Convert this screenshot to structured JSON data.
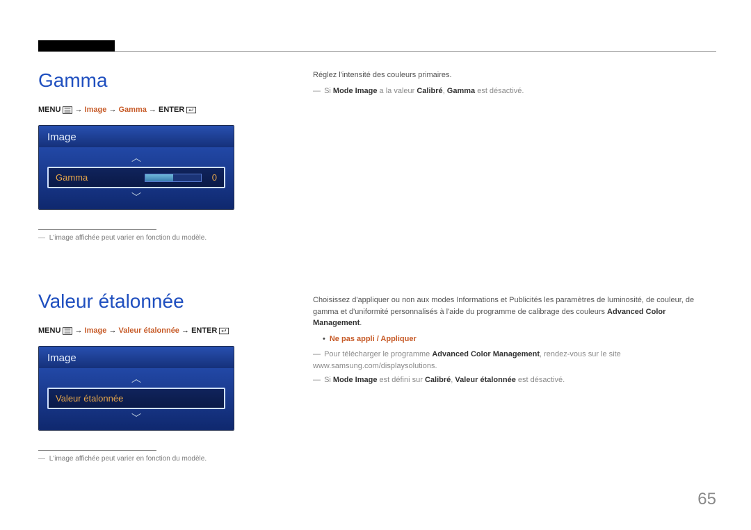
{
  "page_number": "65",
  "gamma": {
    "title": "Gamma",
    "menu_path": {
      "menu": "MENU",
      "image": "Image",
      "item": "Gamma",
      "enter": "ENTER"
    },
    "osd": {
      "header": "Image",
      "row_label": "Gamma",
      "row_value": "0"
    },
    "footnote": "L'image affichée peut varier en fonction du modèle.",
    "right": {
      "line1": "Réglez l'intensité des couleurs primaires.",
      "line2_pre": "Si ",
      "line2_b1": "Mode Image",
      "line2_mid": " a la valeur ",
      "line2_b2": "Calibré",
      "line2_sep": ", ",
      "line2_b3": "Gamma",
      "line2_post": " est désactivé."
    }
  },
  "valeur": {
    "title": "Valeur étalonnée",
    "menu_path": {
      "menu": "MENU",
      "image": "Image",
      "item": "Valeur étalonnée",
      "enter": "ENTER"
    },
    "osd": {
      "header": "Image",
      "row_label": "Valeur étalonnée"
    },
    "footnote": "L'image affichée peut varier en fonction du modèle.",
    "right": {
      "para1_a": "Choisissez d'appliquer ou non aux modes Informations et Publicités les paramètres de luminosité, de couleur, de gamma et d'uniformité personnalisés à l'aide du programme de calibrage des couleurs ",
      "para1_b": "Advanced Color Management",
      "para1_c": ".",
      "options": "Ne pas appli / Appliquer",
      "note1_a": "Pour télécharger le programme ",
      "note1_b": "Advanced Color Management",
      "note1_c": ", rendez-vous sur le site www.samsung.com/displaysolutions.",
      "note2_a": "Si ",
      "note2_b": "Mode Image",
      "note2_c": " est défini sur ",
      "note2_d": "Calibré",
      "note2_e": ", ",
      "note2_f": "Valeur étalonnée",
      "note2_g": " est désactivé."
    }
  }
}
